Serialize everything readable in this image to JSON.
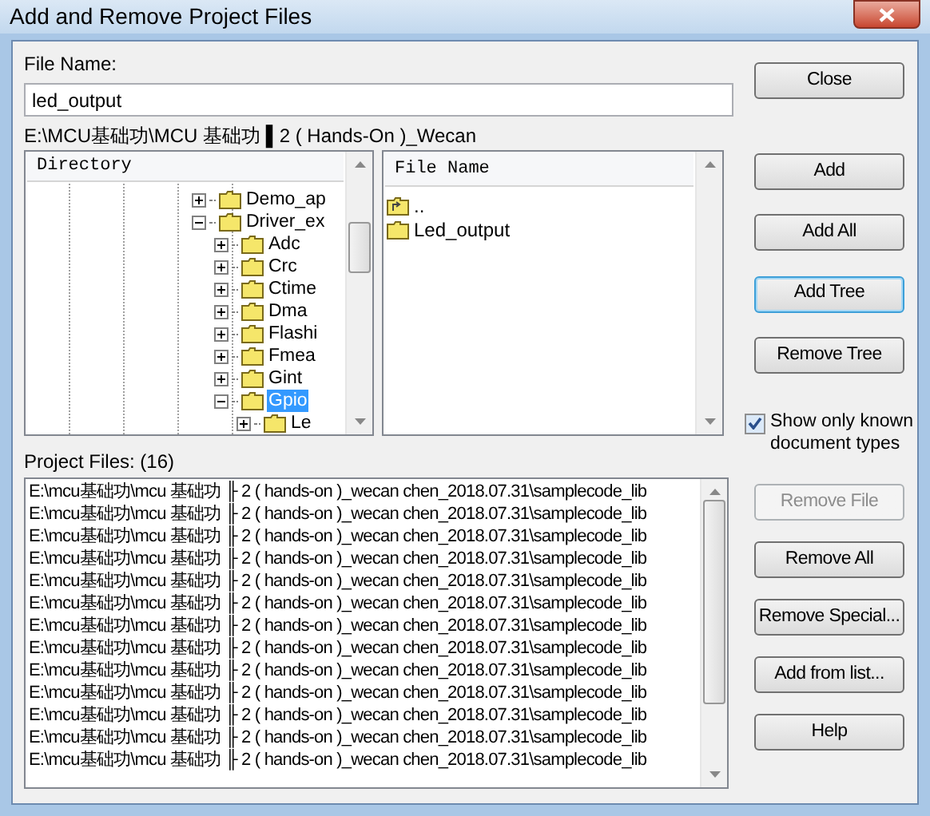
{
  "window": {
    "title": "Add and Remove Project Files"
  },
  "file_name": {
    "label": "File Name:",
    "value": "led_output"
  },
  "path": "E:\\MCU基础功\\MCU 基础功 ▌2 ( Hands-On )_Wecan",
  "directory": {
    "header": "Directory",
    "items": [
      {
        "label": "Demo_ap",
        "expanded": false,
        "selected": false
      },
      {
        "label": "Driver_ex",
        "expanded": true,
        "selected": false,
        "children": [
          {
            "label": "Adc",
            "expanded": false,
            "selected": false
          },
          {
            "label": "Crc",
            "expanded": false,
            "selected": false
          },
          {
            "label": "Ctime",
            "expanded": false,
            "selected": false
          },
          {
            "label": "Dma",
            "expanded": false,
            "selected": false
          },
          {
            "label": "Flashi",
            "expanded": false,
            "selected": false
          },
          {
            "label": "Fmea",
            "expanded": false,
            "selected": false
          },
          {
            "label": "Gint",
            "expanded": false,
            "selected": false
          },
          {
            "label": "Gpio",
            "expanded": true,
            "selected": true,
            "children": [
              {
                "label": "Le",
                "expanded": false,
                "selected": false
              }
            ]
          }
        ]
      }
    ]
  },
  "files": {
    "header": "File Name",
    "items": [
      {
        "kind": "up",
        "label": ".."
      },
      {
        "kind": "folder",
        "label": "Led_output"
      }
    ]
  },
  "buttons_top": [
    {
      "label": "Close",
      "disabled": false,
      "focused": false
    },
    {
      "label": "Add",
      "disabled": false,
      "focused": false
    },
    {
      "label": "Add All",
      "disabled": false,
      "focused": false
    },
    {
      "label": "Add Tree",
      "disabled": false,
      "focused": true
    },
    {
      "label": "Remove Tree",
      "disabled": false,
      "focused": false
    }
  ],
  "show_known": {
    "label": "Show only known document types",
    "checked": true
  },
  "project_files": {
    "label": "Project Files: (16)",
    "rows": [
      "E:\\mcu基础功\\mcu 基础功  ╟ 2 ( hands-on )_wecan chen_2018.07.31\\samplecode_lib",
      "E:\\mcu基础功\\mcu 基础功  ╟ 2 ( hands-on )_wecan chen_2018.07.31\\samplecode_lib",
      "E:\\mcu基础功\\mcu 基础功  ╟ 2 ( hands-on )_wecan chen_2018.07.31\\samplecode_lib",
      "E:\\mcu基础功\\mcu 基础功  ╟ 2 ( hands-on )_wecan chen_2018.07.31\\samplecode_lib",
      "E:\\mcu基础功\\mcu 基础功  ╟ 2 ( hands-on )_wecan chen_2018.07.31\\samplecode_lib",
      "E:\\mcu基础功\\mcu 基础功  ╟ 2 ( hands-on )_wecan chen_2018.07.31\\samplecode_lib",
      "E:\\mcu基础功\\mcu 基础功  ╟ 2 ( hands-on )_wecan chen_2018.07.31\\samplecode_lib",
      "E:\\mcu基础功\\mcu 基础功  ╟ 2 ( hands-on )_wecan chen_2018.07.31\\samplecode_lib",
      "E:\\mcu基础功\\mcu 基础功  ╟ 2 ( hands-on )_wecan chen_2018.07.31\\samplecode_lib",
      "E:\\mcu基础功\\mcu 基础功  ╟ 2 ( hands-on )_wecan chen_2018.07.31\\samplecode_lib",
      "E:\\mcu基础功\\mcu 基础功  ╟ 2 ( hands-on )_wecan chen_2018.07.31\\samplecode_lib",
      "E:\\mcu基础功\\mcu 基础功  ╟ 2 ( hands-on )_wecan chen_2018.07.31\\samplecode_lib",
      "E:\\mcu基础功\\mcu 基础功  ╟ 2 ( hands-on )_wecan chen_2018.07.31\\samplecode_lib"
    ]
  },
  "buttons_bottom": [
    {
      "label": "Remove File",
      "disabled": true,
      "focused": false
    },
    {
      "label": "Remove All",
      "disabled": false,
      "focused": false
    },
    {
      "label": "Remove Special...",
      "disabled": false,
      "focused": false
    },
    {
      "label": "Add from list...",
      "disabled": false,
      "focused": false
    },
    {
      "label": "Help",
      "disabled": false,
      "focused": false
    }
  ]
}
